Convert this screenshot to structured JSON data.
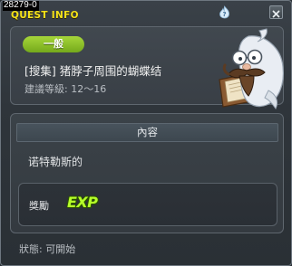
{
  "window": {
    "id_label": "28279-0",
    "title": "QUEST INFO"
  },
  "quest": {
    "category": "一般",
    "name": "[搜集] 猪脖子周围的蝴蝶结",
    "level_text": "建議等級: 12～16"
  },
  "content": {
    "section_header": "內容",
    "description": "诺特勒斯的",
    "reward_label": "獎勵",
    "reward_icon_text": "EXP"
  },
  "status_text": "狀態: 可開始",
  "icons": {
    "help": "flame-question-icon",
    "close": "close-button",
    "npc": "npc-portrait-scholar-icon"
  },
  "colors": {
    "title": "#f4e21a",
    "category_pill": "#8cc52a",
    "exp_text": "#b6ff2a"
  }
}
